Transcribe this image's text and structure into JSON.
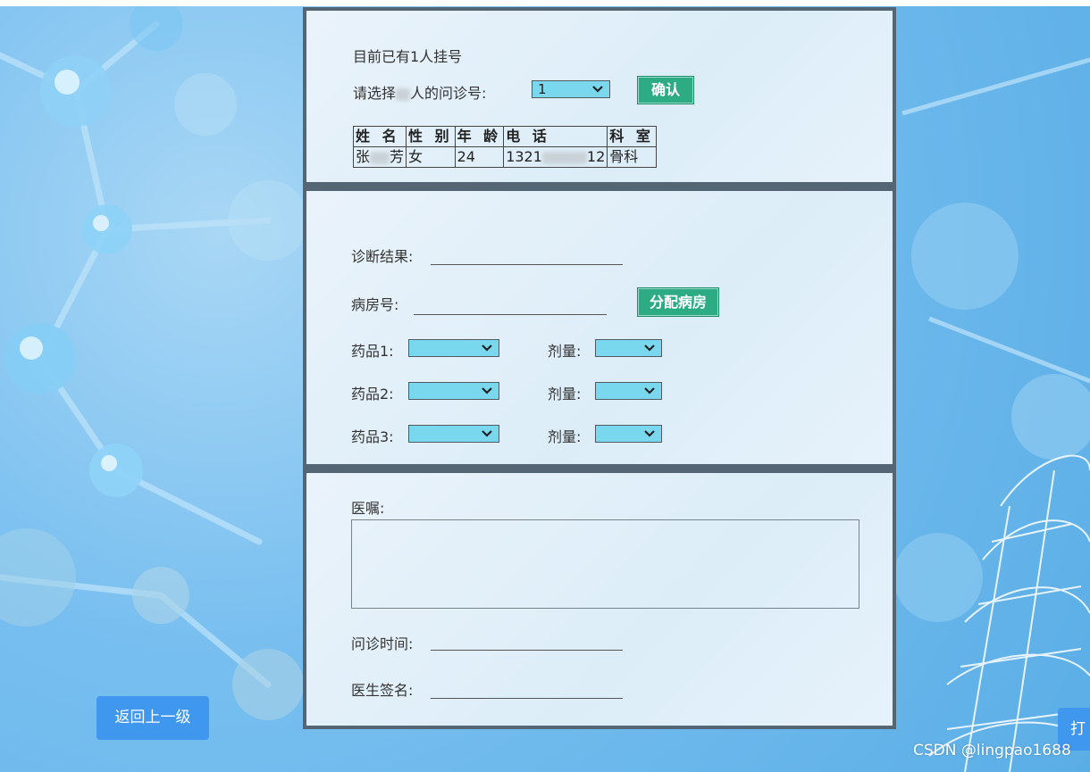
{
  "header": {
    "registered_count_text": "目前已有1人挂号",
    "select_prompt_prefix": "请选择",
    "select_prompt_suffix": "人的问诊号:",
    "visit_number_value": "1",
    "confirm_label": "确认"
  },
  "patient_table": {
    "columns": [
      "姓 名",
      "性 别",
      "年 龄",
      "电 话",
      "科 室"
    ],
    "row": {
      "name_start": "张",
      "name_end": "芳",
      "gender": "女",
      "age": "24",
      "phone_start": "1321",
      "phone_end": "12",
      "department": "骨科"
    }
  },
  "diagnosis": {
    "result_label": "诊断结果:",
    "result_value": "",
    "room_label": "病房号:",
    "room_value": "",
    "assign_room_label": "分配病房",
    "medicines": [
      {
        "label": "药品1:",
        "value": "",
        "dose_label": "剂量:",
        "dose_value": ""
      },
      {
        "label": "药品2:",
        "value": "",
        "dose_label": "剂量:",
        "dose_value": ""
      },
      {
        "label": "药品3:",
        "value": "",
        "dose_label": "剂量:",
        "dose_value": ""
      }
    ]
  },
  "advice": {
    "label": "医嘱:",
    "value": "",
    "visit_time_label": "问诊时间:",
    "visit_time_value": "",
    "signature_label": "医生签名:",
    "signature_value": ""
  },
  "footer": {
    "back_label": "返回上一级",
    "print_label": "打",
    "watermark": "CSDN @lingpao1688"
  },
  "colors": {
    "select_bg": "#79d8ee",
    "button_green": "#2dab83",
    "button_blue": "#3f97ee",
    "panel_border": "#546673"
  }
}
